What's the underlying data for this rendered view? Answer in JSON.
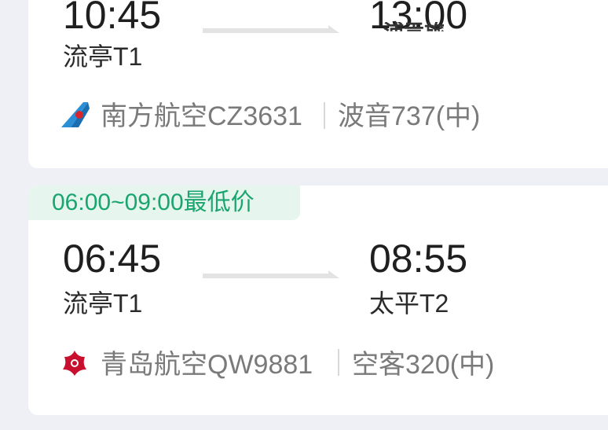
{
  "flights": [
    {
      "depart_time": "10:45",
      "depart_airport": "流亭T1",
      "arrive_time": "13:00",
      "arrive_airport": "浦贡旅",
      "airline_flight": "南方航空CZ3631",
      "aircraft": "波音737(中)",
      "airline_logo_icon": "china-southern-logo-icon"
    },
    {
      "tag": "06:00~09:00最低价",
      "depart_time": "06:45",
      "depart_airport": "流亭T1",
      "arrive_time": "08:55",
      "arrive_airport": "太平T2",
      "airline_flight": "青岛航空QW9881",
      "aircraft": "空客320(中)",
      "airline_logo_icon": "qingdao-airlines-logo-icon"
    }
  ],
  "colors": {
    "background": "#eef0f5",
    "tag_bg": "#e6f6ef",
    "tag_text": "#1aa56f",
    "china_southern_blue": "#2a8fd6",
    "qingdao_red": "#c8102e"
  }
}
